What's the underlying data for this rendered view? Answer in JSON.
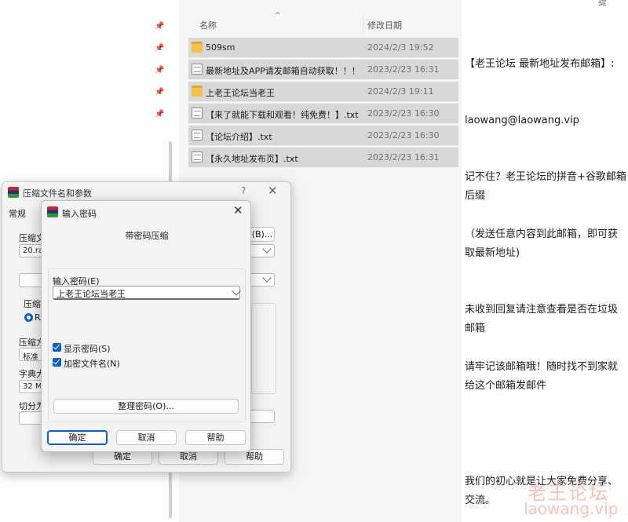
{
  "top_right_fragment": "提",
  "explorer": {
    "columns": {
      "name": "名称",
      "date": "修改日期",
      "sort_caret": "^"
    },
    "pin_glyph": "📌",
    "files": [
      {
        "name": "509sm",
        "date": "2024/2/3 19:52",
        "type": "folder"
      },
      {
        "name": "最新地址及APP请发邮箱自动获取！！！ ...",
        "date": "2023/2/23 16:31",
        "type": "txt"
      },
      {
        "name": "上老王论坛当老王",
        "date": "2024/2/3 19:11",
        "type": "folder"
      },
      {
        "name": "【来了就能下载和观看！纯免费！】.txt",
        "date": "2023/2/23 16:30",
        "type": "txt"
      },
      {
        "name": "【论坛介绍】.txt",
        "date": "2023/2/23 16:30",
        "type": "txt"
      },
      {
        "name": "【永久地址发布页】.txt",
        "date": "2023/2/23 16:31",
        "type": "txt"
      }
    ]
  },
  "article": {
    "p1": "【老王论坛 最新地址发布邮箱】:",
    "p2": "laowang@laowang.vip",
    "p3": "记不住？老王论坛的拼音+谷歌邮箱后缀",
    "p4": "（发送任意内容到此邮箱，即可获取最新地址)",
    "p5": "未收到回复请注意查看是否在垃圾邮箱",
    "p6": "请牢记该邮箱哦！随时找不到家就给这个邮箱发邮件",
    "p7": "我们的初心就是让大家免费分享、交流。",
    "watermark_cn": "老王论坛",
    "watermark_url": "laowang.vip"
  },
  "back_dialog": {
    "title": "压缩文件名和参数",
    "help_glyph": "?",
    "close_glyph": "✕",
    "tab_general": "常规",
    "archive_name_label": "压缩文",
    "archive_name_value": "20.rar",
    "browse_button": "(B)...",
    "format_label": "压缩",
    "rar_option": "RA",
    "method_label": "压缩方",
    "method_value": "标准",
    "dict_label": "字典大",
    "dict_value": "32 MB",
    "split_label": "切分为",
    "paren_fragment": ")",
    "ok": "确定",
    "cancel": "取消",
    "help": "帮助"
  },
  "front_dialog": {
    "title": "输入密码",
    "close_glyph": "✕",
    "heading": "带密码压缩",
    "password_label": "输入密码(E)",
    "password_value": "上老王论坛当老王",
    "show_password": "显示密码(S)",
    "encrypt_names": "加密文件名(N)",
    "manage_button": "整理密码(O)...",
    "ok": "确定",
    "cancel": "取消",
    "help": "帮助"
  }
}
